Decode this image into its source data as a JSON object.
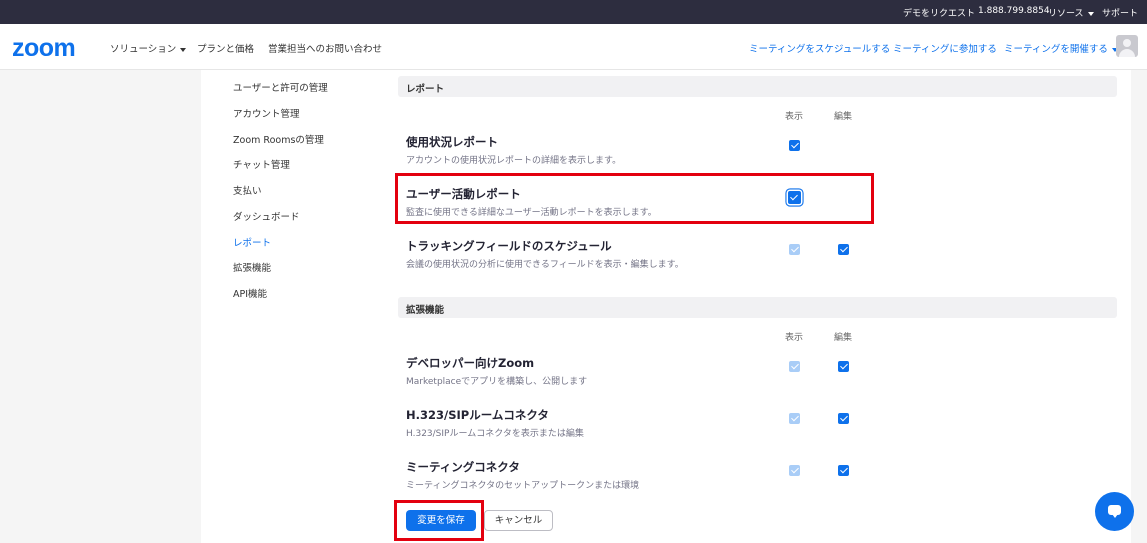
{
  "topbar": {
    "demo": "デモをリクエスト",
    "phone": "1.888.799.8854",
    "resources": "リソース",
    "support": "サポート"
  },
  "header": {
    "logo": "zoom",
    "nav": [
      "ソリューション",
      "プランと価格",
      "営業担当へのお問い合わせ"
    ],
    "actions": [
      "ミーティングをスケジュールする",
      "ミーティングに参加する",
      "ミーティングを開催する"
    ]
  },
  "sidebar": {
    "items": [
      {
        "label": "ユーザーと許可の管理"
      },
      {
        "label": "アカウント管理"
      },
      {
        "label": "Zoom Roomsの管理"
      },
      {
        "label": "チャット管理"
      },
      {
        "label": "支払い"
      },
      {
        "label": "ダッシュボード"
      },
      {
        "label": "レポート",
        "active": true
      },
      {
        "label": "拡張機能"
      },
      {
        "label": "API機能"
      }
    ]
  },
  "sections": [
    {
      "title": "レポート",
      "view_label": "表示",
      "edit_label": "編集",
      "rows": [
        {
          "title": "使用状況レポート",
          "desc": "アカウントの使用状況レポートの詳細を表示します。",
          "view": "checked",
          "edit": "none"
        },
        {
          "title": "ユーザー活動レポート",
          "desc": "監査に使用できる詳細なユーザー活動レポートを表示します。",
          "view": "checked-focused",
          "edit": "none"
        },
        {
          "title": "トラッキングフィールドのスケジュール",
          "desc": "会議の使用状況の分析に使用できるフィールドを表示・編集します。",
          "view": "checked-disabled",
          "edit": "checked"
        }
      ]
    },
    {
      "title": "拡張機能",
      "view_label": "表示",
      "edit_label": "編集",
      "rows": [
        {
          "title": "デベロッパー向けZoom",
          "desc": "Marketplaceでアプリを構築し、公開します",
          "view": "checked-disabled",
          "edit": "checked"
        },
        {
          "title": "H.323/SIPルームコネクタ",
          "desc": "H.323/SIPルームコネクタを表示または編集",
          "view": "checked-disabled",
          "edit": "checked"
        },
        {
          "title": "ミーティングコネクタ",
          "desc": "ミーティングコネクタのセットアップトークンまたは環境",
          "view": "checked-disabled",
          "edit": "checked"
        }
      ]
    }
  ],
  "buttons": {
    "save": "変更を保存",
    "cancel": "キャンセル"
  },
  "colors": {
    "accent": "#0e71eb",
    "highlight": "#e3000f",
    "topbar": "#2d2d3f"
  }
}
